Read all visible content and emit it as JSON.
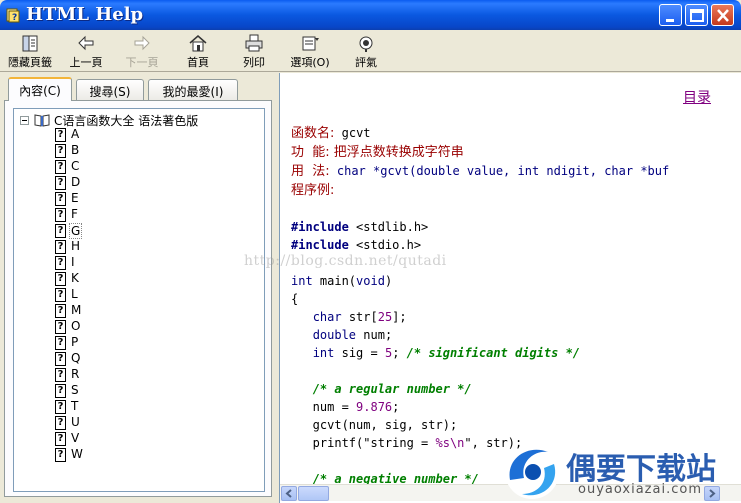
{
  "window": {
    "title": "HTML Help"
  },
  "toolbar": {
    "buttons": [
      {
        "label": "隱藏頁籤",
        "icon": "hide-tabs-icon"
      },
      {
        "label": "上一頁",
        "icon": "back-arrow-icon"
      },
      {
        "label": "下一頁",
        "icon": "forward-arrow-icon",
        "disabled": true
      },
      {
        "label": "首頁",
        "icon": "home-icon"
      },
      {
        "label": "列印",
        "icon": "print-icon"
      },
      {
        "label": "選項(O)",
        "icon": "options-icon"
      },
      {
        "label": "評氣",
        "icon": "jump-icon"
      }
    ]
  },
  "tabs": [
    {
      "label": "內容(C)",
      "active": true
    },
    {
      "label": "搜尋(S)"
    },
    {
      "label": "我的最愛(I)"
    }
  ],
  "tree": {
    "root_label": "C语言函数大全 语法著色版",
    "items": [
      "A",
      "B",
      "C",
      "D",
      "E",
      "F",
      "G",
      "H",
      "I",
      "K",
      "L",
      "M",
      "O",
      "P",
      "Q",
      "R",
      "S",
      "T",
      "U",
      "V",
      "W"
    ],
    "selected": "G"
  },
  "content": {
    "toc_link": "目录",
    "func_label": "函数名:",
    "func_name": " gcvt",
    "feature_label": "功  能:",
    "feature_text": " 把浮点数转换成字符串",
    "usage_label": "用  法:",
    "usage_code": " char *gcvt(double value, int ndigit, char *buf",
    "example_label": "程序例:",
    "watermark": "http://blog.csdn.net/qutadi"
  },
  "logo": {
    "name": "偶要下载站",
    "url": "ouyaoxiazai.com"
  },
  "colors": {
    "titlebar": "#0a58e0",
    "keyword": "#00007f",
    "comment": "#007f00",
    "number": "#7f007f",
    "label": "#990000",
    "link": "#800080"
  }
}
